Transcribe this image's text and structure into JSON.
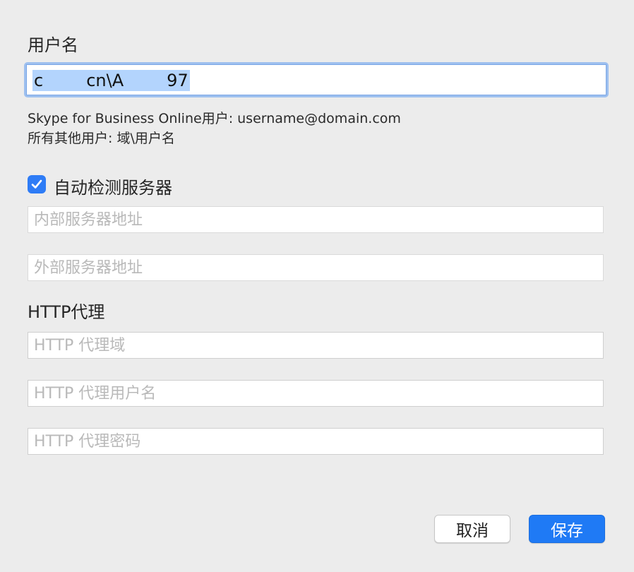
{
  "form": {
    "username_label": "用户名",
    "username_value": "c        cn\\A        97",
    "hint_skype": "Skype for Business Online用户: username@domain.com",
    "hint_other": "所有其他用户: 域\\用户名",
    "auto_detect_label": "自动检测服务器",
    "auto_detect_checked": true,
    "internal_server_placeholder": "内部服务器地址",
    "external_server_placeholder": "外部服务器地址",
    "http_proxy_label": "HTTP代理",
    "http_proxy_domain_placeholder": "HTTP 代理域",
    "http_proxy_username_placeholder": "HTTP 代理用户名",
    "http_proxy_password_placeholder": "HTTP 代理密码"
  },
  "buttons": {
    "cancel": "取消",
    "save": "保存"
  },
  "icons": {
    "checkbox": "checkmark-icon"
  },
  "colors": {
    "accent": "#1f7af5",
    "focus_ring": "#9ec0ef",
    "selection": "#b3d4fd"
  }
}
